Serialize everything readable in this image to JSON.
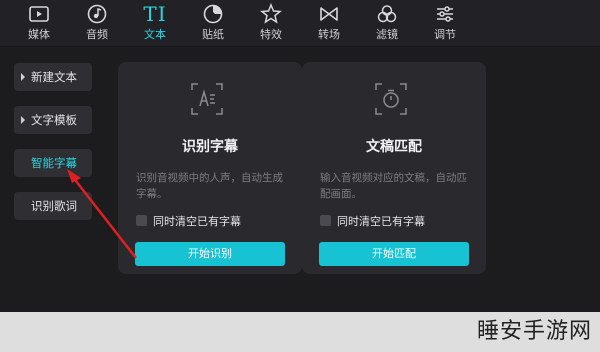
{
  "tabs": [
    {
      "label": "媒体",
      "icon": "media-icon"
    },
    {
      "label": "音频",
      "icon": "music-icon"
    },
    {
      "label": "文本",
      "icon": "text-icon",
      "glyph": "TI",
      "active": true
    },
    {
      "label": "贴纸",
      "icon": "sticker-icon"
    },
    {
      "label": "特效",
      "icon": "effects-icon"
    },
    {
      "label": "转场",
      "icon": "transition-icon"
    },
    {
      "label": "滤镜",
      "icon": "filter-icon"
    },
    {
      "label": "调节",
      "icon": "adjust-icon"
    }
  ],
  "sidebar": {
    "items": [
      {
        "label": "新建文本",
        "expandable": true
      },
      {
        "label": "文字模板",
        "expandable": true
      },
      {
        "label": "智能字幕",
        "active": true
      },
      {
        "label": "识别歌词"
      }
    ]
  },
  "cards": [
    {
      "title": "识别字幕",
      "icon": "speech-recognition-icon",
      "desc": "识别音视频中的人声，自动生成字幕。",
      "checkbox_label": "同时清空已有字幕",
      "button": "开始识别"
    },
    {
      "title": "文稿匹配",
      "icon": "timer-match-icon",
      "desc": "输入音视频对应的文稿，自动匹配画面。",
      "checkbox_label": "同时清空已有字幕",
      "button": "开始匹配"
    }
  ],
  "watermark": "睡安手游网",
  "colors": {
    "accent": "#2bd5e0",
    "button": "#17c3d2",
    "panel": "#1c1c1f",
    "card": "#2a2a2e",
    "annotation_arrow": "#e02020"
  }
}
